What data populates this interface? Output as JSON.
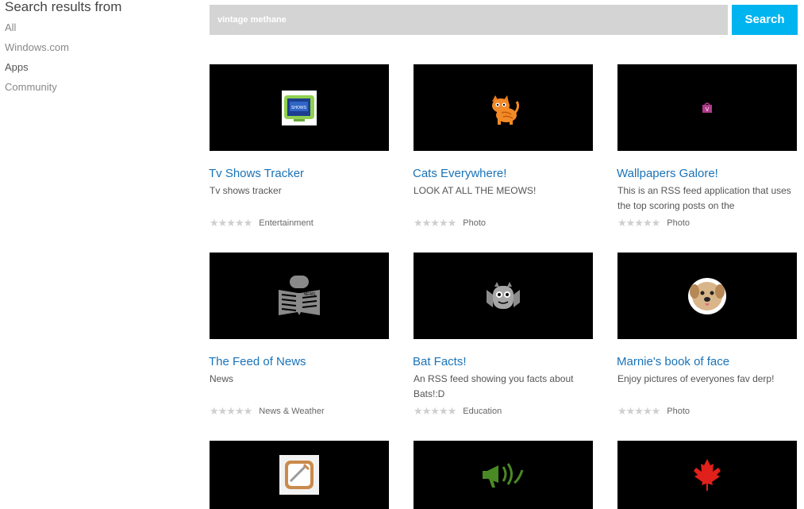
{
  "sidebar": {
    "heading": "Search results from",
    "items": [
      {
        "label": "All"
      },
      {
        "label": "Windows.com"
      },
      {
        "label": "Apps"
      },
      {
        "label": "Community"
      }
    ]
  },
  "search": {
    "value": "vintage methane",
    "button_label": "Search"
  },
  "results": [
    {
      "title": "Tv Shows Tracker",
      "description": "Tv shows tracker",
      "category": "Entertainment",
      "icon": "tv-icon",
      "rating": "★★★★★"
    },
    {
      "title": "Cats Everywhere!",
      "description": "LOOK AT ALL THE MEOWS!",
      "category": "Photo",
      "icon": "cat-icon",
      "rating": "★★★★★"
    },
    {
      "title": "Wallpapers Galore!",
      "description": "This is an RSS feed application that uses the top scoring posts on the",
      "category": "Photo",
      "icon": "bag-icon",
      "rating": "★★★★★"
    },
    {
      "title": "The Feed of News",
      "description": "News",
      "category": "News & Weather",
      "icon": "newspaper-icon",
      "rating": "★★★★★"
    },
    {
      "title": "Bat Facts!",
      "description": "An RSS feed showing you facts about Bats!:D",
      "category": "Education",
      "icon": "bat-icon",
      "rating": "★★★★★"
    },
    {
      "title": "Marnie's book of face",
      "description": "Enjoy pictures of everyones fav derp!",
      "category": "Photo",
      "icon": "dog-icon",
      "rating": "★★★★★"
    },
    {
      "title": "",
      "description": "",
      "category": "",
      "icon": "notepad-icon",
      "rating": ""
    },
    {
      "title": "",
      "description": "",
      "category": "",
      "icon": "megaphone-icon",
      "rating": ""
    },
    {
      "title": "",
      "description": "",
      "category": "",
      "icon": "maple-leaf-icon",
      "rating": ""
    }
  ]
}
